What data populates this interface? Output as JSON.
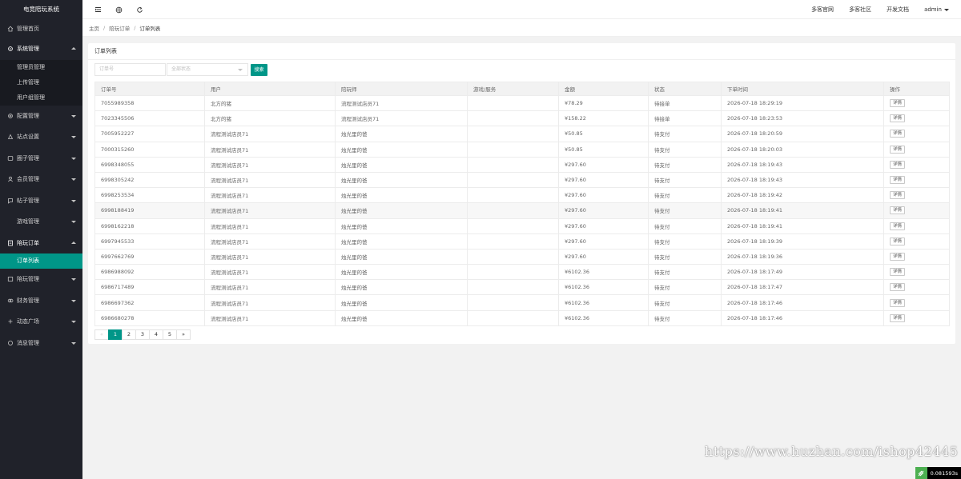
{
  "app": {
    "title": "电竞陪玩系统"
  },
  "sidebar": {
    "items": [
      {
        "icon": "home-icon",
        "label": "管理首页",
        "arrow": ""
      },
      {
        "icon": "gear-icon",
        "label": "系统管理",
        "arrow": "up",
        "children": [
          "管理员管理",
          "上传管理",
          "用户组管理"
        ]
      },
      {
        "icon": "settings-icon",
        "label": "配置管理",
        "arrow": "down"
      },
      {
        "icon": "site-icon",
        "label": "站点设置",
        "arrow": "down"
      },
      {
        "icon": "circle-icon",
        "label": "圈子管理",
        "arrow": "down"
      },
      {
        "icon": "user-icon",
        "label": "会员管理",
        "arrow": "down"
      },
      {
        "icon": "post-icon",
        "label": "帖子管理",
        "arrow": "down"
      },
      {
        "icon": "",
        "label": "游戏管理",
        "arrow": "down"
      },
      {
        "icon": "order-icon",
        "label": "陪玩订单",
        "arrow": "up",
        "children": [
          "订单列表"
        ]
      },
      {
        "icon": "companion-icon",
        "label": "陪玩管理",
        "arrow": "down"
      },
      {
        "icon": "finance-icon",
        "label": "财务管理",
        "arrow": "down"
      },
      {
        "icon": "square-icon",
        "label": "动态广场",
        "arrow": "down"
      },
      {
        "icon": "message-icon",
        "label": "消息管理",
        "arrow": "down"
      }
    ]
  },
  "header": {
    "links": [
      "多客官网",
      "多客社区",
      "开发文档"
    ],
    "user": "admin"
  },
  "breadcrumb": {
    "home": "主页",
    "parent": "陪玩订单",
    "current": "订单列表"
  },
  "card": {
    "title": "订单列表",
    "filters": {
      "order_placeholder": "订单号",
      "status_placeholder": "全部状态",
      "search_label": "搜索"
    },
    "columns": [
      "订单号",
      "用户",
      "陪玩师",
      "游戏/服务",
      "金额",
      "状态",
      "下单时间",
      "操作"
    ],
    "rows": [
      [
        "7055989358",
        "北方的猪",
        "流程测试店员71",
        "",
        "¥78.29",
        "待接单",
        "2026-07-18 18:29:19",
        "详情"
      ],
      [
        "7023345506",
        "北方的猪",
        "流程测试店员71",
        "",
        "¥158.22",
        "待接单",
        "2026-07-18 18:23:53",
        "详情"
      ],
      [
        "7005952227",
        "流程测试店员71",
        "烛光里的爸",
        "",
        "¥50.85",
        "待支付",
        "2026-07-18 18:20:59",
        "详情"
      ],
      [
        "7000315260",
        "流程测试店员71",
        "烛光里的爸",
        "",
        "¥50.85",
        "待支付",
        "2026-07-18 18:20:03",
        "详情"
      ],
      [
        "6998348055",
        "流程测试店员71",
        "烛光里的爸",
        "",
        "¥297.60",
        "待支付",
        "2026-07-18 18:19:43",
        "详情"
      ],
      [
        "6998305242",
        "流程测试店员71",
        "烛光里的爸",
        "",
        "¥297.60",
        "待支付",
        "2026-07-18 18:19:43",
        "详情"
      ],
      [
        "6998253534",
        "流程测试店员71",
        "烛光里的爸",
        "",
        "¥297.60",
        "待支付",
        "2026-07-18 18:19:42",
        "详情"
      ],
      [
        "6998188419",
        "流程测试店员71",
        "烛光里的爸",
        "",
        "¥297.60",
        "待支付",
        "2026-07-18 18:19:41",
        "详情"
      ],
      [
        "6998162218",
        "流程测试店员71",
        "烛光里的爸",
        "",
        "¥297.60",
        "待支付",
        "2026-07-18 18:19:41",
        "详情"
      ],
      [
        "6997945533",
        "流程测试店员71",
        "烛光里的爸",
        "",
        "¥297.60",
        "待支付",
        "2026-07-18 18:19:39",
        "详情"
      ],
      [
        "6997662769",
        "流程测试店员71",
        "烛光里的爸",
        "",
        "¥297.60",
        "待支付",
        "2026-07-18 18:19:36",
        "详情"
      ],
      [
        "6986988092",
        "流程测试店员71",
        "烛光里的爸",
        "",
        "¥6102.36",
        "待支付",
        "2026-07-18 18:17:49",
        "详情"
      ],
      [
        "6986717489",
        "流程测试店员71",
        "烛光里的爸",
        "",
        "¥6102.36",
        "待支付",
        "2026-07-18 18:17:47",
        "详情"
      ],
      [
        "6986697362",
        "流程测试店员71",
        "烛光里的爸",
        "",
        "¥6102.36",
        "待支付",
        "2026-07-18 18:17:46",
        "详情"
      ],
      [
        "6986680278",
        "流程测试店员71",
        "烛光里的爸",
        "",
        "¥6102.36",
        "待支付",
        "2026-07-18 18:17:46",
        "详情"
      ]
    ],
    "pager": {
      "prev": "«",
      "pages": [
        "1",
        "2",
        "3",
        "4",
        "5"
      ],
      "next": "»",
      "active": "1"
    }
  },
  "watermark": "https://www.huzhan.com/ishop42445",
  "timer": "0.081593s",
  "colors": {
    "sidebar_bg": "#20222a",
    "accent": "#009688"
  }
}
